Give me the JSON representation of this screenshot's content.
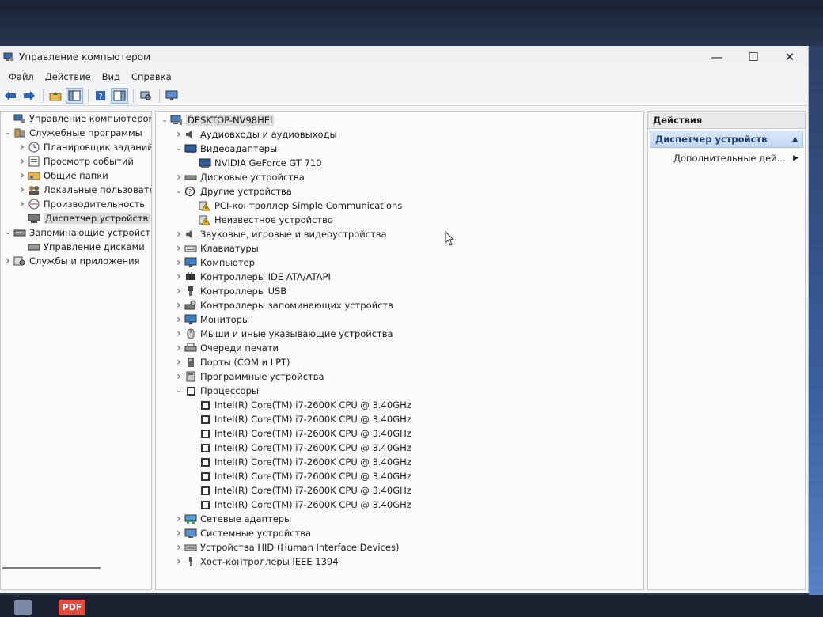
{
  "window": {
    "title": "Управление компьютером"
  },
  "menu": [
    "Файл",
    "Действие",
    "Вид",
    "Справка"
  ],
  "left_tree": [
    {
      "label": "Управление компьютером (л",
      "depth": 0,
      "toggle": "",
      "icon": "computer-management-icon"
    },
    {
      "label": "Служебные программы",
      "depth": 0,
      "toggle": "v",
      "icon": "tools-icon"
    },
    {
      "label": "Планировщик заданий",
      "depth": 1,
      "toggle": ">",
      "icon": "clock-icon"
    },
    {
      "label": "Просмотр событий",
      "depth": 1,
      "toggle": ">",
      "icon": "event-viewer-icon"
    },
    {
      "label": "Общие папки",
      "depth": 1,
      "toggle": ">",
      "icon": "shared-folder-icon"
    },
    {
      "label": "Локальные пользовате",
      "depth": 1,
      "toggle": ">",
      "icon": "users-icon"
    },
    {
      "label": "Производительность",
      "depth": 1,
      "toggle": ">",
      "icon": "performance-icon"
    },
    {
      "label": "Диспетчер устройств",
      "depth": 1,
      "toggle": "",
      "icon": "device-manager-icon",
      "selected": true
    },
    {
      "label": "Запоминающие устройст",
      "depth": 0,
      "toggle": "v",
      "icon": "storage-icon"
    },
    {
      "label": "Управление дисками",
      "depth": 1,
      "toggle": "",
      "icon": "disk-management-icon"
    },
    {
      "label": "Службы и приложения",
      "depth": 0,
      "toggle": ">",
      "icon": "services-icon"
    }
  ],
  "device_tree": [
    {
      "label": "DESKTOP-NV98HEI",
      "depth": 0,
      "toggle": "v",
      "icon": "computer-icon",
      "selected": true
    },
    {
      "label": "Аудиовходы и аудиовыходы",
      "depth": 1,
      "toggle": ">",
      "icon": "speaker-icon"
    },
    {
      "label": "Видеоадаптеры",
      "depth": 1,
      "toggle": "v",
      "icon": "display-adapter-icon"
    },
    {
      "label": "NVIDIA GeForce GT 710",
      "depth": 2,
      "toggle": "",
      "icon": "display-adapter-icon"
    },
    {
      "label": "Дисковые устройства",
      "depth": 1,
      "toggle": ">",
      "icon": "disk-drive-icon"
    },
    {
      "label": "Другие устройства",
      "depth": 1,
      "toggle": "v",
      "icon": "unknown-device-icon"
    },
    {
      "label": "PCI-контроллер Simple Communications",
      "depth": 2,
      "toggle": "",
      "icon": "warning-device-icon"
    },
    {
      "label": "Неизвестное устройство",
      "depth": 2,
      "toggle": "",
      "icon": "warning-device-icon"
    },
    {
      "label": "Звуковые, игровые и видеоустройства",
      "depth": 1,
      "toggle": ">",
      "icon": "speaker-icon"
    },
    {
      "label": "Клавиатуры",
      "depth": 1,
      "toggle": ">",
      "icon": "keyboard-icon"
    },
    {
      "label": "Компьютер",
      "depth": 1,
      "toggle": ">",
      "icon": "monitor-icon"
    },
    {
      "label": "Контроллеры IDE ATA/ATAPI",
      "depth": 1,
      "toggle": ">",
      "icon": "ide-controller-icon"
    },
    {
      "label": "Контроллеры USB",
      "depth": 1,
      "toggle": ">",
      "icon": "usb-icon"
    },
    {
      "label": "Контроллеры запоминающих устройств",
      "depth": 1,
      "toggle": ">",
      "icon": "storage-controller-icon"
    },
    {
      "label": "Мониторы",
      "depth": 1,
      "toggle": ">",
      "icon": "monitor-icon"
    },
    {
      "label": "Мыши и иные указывающие устройства",
      "depth": 1,
      "toggle": ">",
      "icon": "mouse-icon"
    },
    {
      "label": "Очереди печати",
      "depth": 1,
      "toggle": ">",
      "icon": "printer-icon"
    },
    {
      "label": "Порты (COM и LPT)",
      "depth": 1,
      "toggle": ">",
      "icon": "port-icon"
    },
    {
      "label": "Программные устройства",
      "depth": 1,
      "toggle": ">",
      "icon": "software-device-icon"
    },
    {
      "label": "Процессоры",
      "depth": 1,
      "toggle": "v",
      "icon": "cpu-icon"
    },
    {
      "label": "Intel(R) Core(TM) i7-2600K CPU @ 3.40GHz",
      "depth": 2,
      "toggle": "",
      "icon": "cpu-icon"
    },
    {
      "label": "Intel(R) Core(TM) i7-2600K CPU @ 3.40GHz",
      "depth": 2,
      "toggle": "",
      "icon": "cpu-icon"
    },
    {
      "label": "Intel(R) Core(TM) i7-2600K CPU @ 3.40GHz",
      "depth": 2,
      "toggle": "",
      "icon": "cpu-icon"
    },
    {
      "label": "Intel(R) Core(TM) i7-2600K CPU @ 3.40GHz",
      "depth": 2,
      "toggle": "",
      "icon": "cpu-icon"
    },
    {
      "label": "Intel(R) Core(TM) i7-2600K CPU @ 3.40GHz",
      "depth": 2,
      "toggle": "",
      "icon": "cpu-icon"
    },
    {
      "label": "Intel(R) Core(TM) i7-2600K CPU @ 3.40GHz",
      "depth": 2,
      "toggle": "",
      "icon": "cpu-icon"
    },
    {
      "label": "Intel(R) Core(TM) i7-2600K CPU @ 3.40GHz",
      "depth": 2,
      "toggle": "",
      "icon": "cpu-icon"
    },
    {
      "label": "Intel(R) Core(TM) i7-2600K CPU @ 3.40GHz",
      "depth": 2,
      "toggle": "",
      "icon": "cpu-icon"
    },
    {
      "label": "Сетевые адаптеры",
      "depth": 1,
      "toggle": ">",
      "icon": "network-adapter-icon"
    },
    {
      "label": "Системные устройства",
      "depth": 1,
      "toggle": ">",
      "icon": "system-device-icon"
    },
    {
      "label": "Устройства HID (Human Interface Devices)",
      "depth": 1,
      "toggle": ">",
      "icon": "hid-icon"
    },
    {
      "label": "Хост-контроллеры IEEE 1394",
      "depth": 1,
      "toggle": ">",
      "icon": "ieee1394-icon"
    }
  ],
  "actions": {
    "header": "Действия",
    "section": "Диспетчер устройств",
    "items": [
      "Дополнительные дей..."
    ]
  },
  "taskbar": {
    "pdf_label": "PDF"
  },
  "colors": {
    "accent": "#1e3c6d",
    "selection": "#dcdcdc",
    "section_bg": "#c3d8f1"
  }
}
